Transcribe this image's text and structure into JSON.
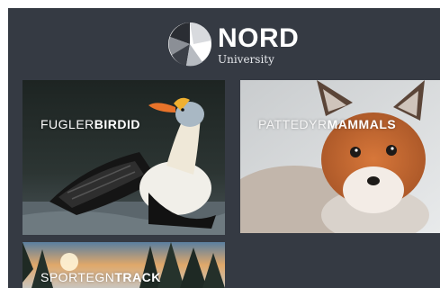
{
  "brand": {
    "name": "NORD",
    "subtitle": "University"
  },
  "tiles": [
    {
      "id": "birds",
      "light": "FUGLER",
      "bold": "BIRDID"
    },
    {
      "id": "mammals",
      "light": "PATTEDYR",
      "bold": "MAMMALS"
    },
    {
      "id": "tracks",
      "light": "SPORTEGN",
      "bold": "TRACK"
    }
  ],
  "colors": {
    "background": "#353a43",
    "text": "#ffffff"
  }
}
